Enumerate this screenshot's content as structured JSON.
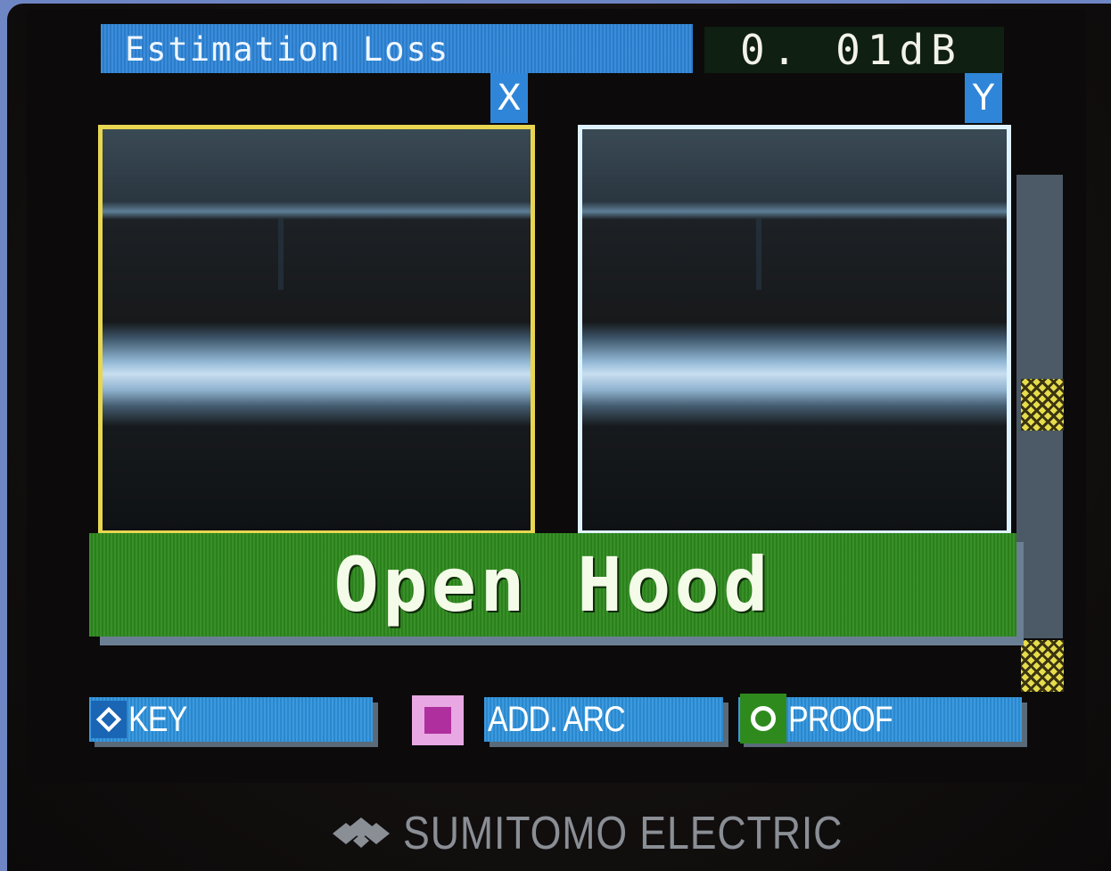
{
  "header": {
    "title": "Estimation Loss",
    "loss_value": "0. 01dB"
  },
  "views": {
    "x_label": "X",
    "y_label": "Y"
  },
  "message": "Open Hood",
  "softkeys": {
    "key": {
      "label": "KEY",
      "icon": "diamond-icon"
    },
    "add_arc": {
      "label": "ADD. ARC",
      "icon": "square-icon"
    },
    "proof": {
      "label": "PROOF",
      "icon": "circle-icon"
    }
  },
  "brand": {
    "name": "SUMITOMO ELECTRIC"
  },
  "colors": {
    "header_blue": "#2f86d9",
    "banner_green": "#2e8a1e",
    "x_frame": "#e8d650",
    "y_frame": "#dff2ff",
    "scale_marker": "#e6dc4c"
  }
}
